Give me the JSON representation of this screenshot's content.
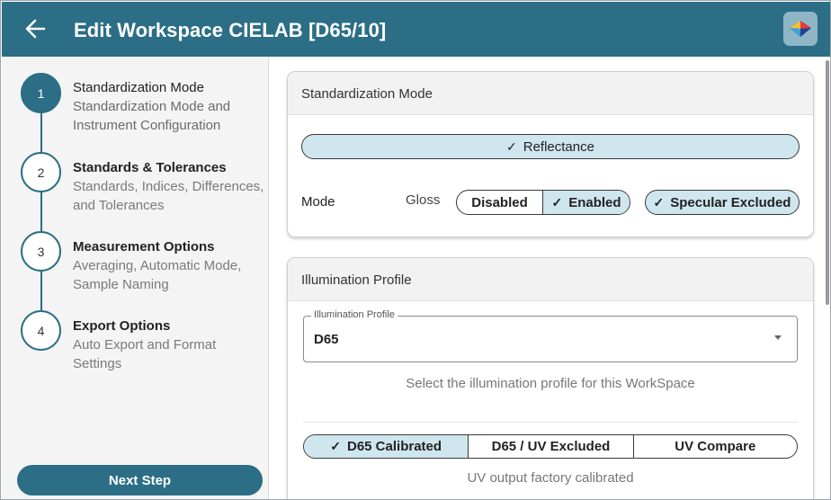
{
  "header": {
    "title": "Edit Workspace CIELAB [D65/10]",
    "back_icon": "arrow-left-icon",
    "logo_icon": "color-diamond-logo-icon",
    "background": "#2b6e86"
  },
  "steps": [
    {
      "number": "1",
      "title": "Standardization Mode",
      "subtitle": "Standardization Mode and Instrument Configuration",
      "active": true
    },
    {
      "number": "2",
      "title": "Standards & Tolerances",
      "subtitle": "Standards, Indices, Differences, and Tolerances",
      "active": false
    },
    {
      "number": "3",
      "title": "Measurement Options",
      "subtitle": "Averaging, Automatic Mode, Sample Naming",
      "active": false
    },
    {
      "number": "4",
      "title": "Export Options",
      "subtitle": "Auto Export and Format Settings",
      "active": false
    }
  ],
  "next_button": "Next Step",
  "standardization": {
    "header": "Standardization Mode",
    "reflectance_label": "Reflectance",
    "mode_label": "Mode",
    "gloss_label": "Gloss",
    "gloss_options": [
      "Disabled",
      "Enabled"
    ],
    "gloss_selected": "Enabled",
    "specular_label": "Specular Excluded"
  },
  "illumination": {
    "header": "Illumination Profile",
    "field_label": "Illumination Profile",
    "field_value": "D65",
    "helper": "Select the illumination profile for this WorkSpace",
    "uv_options": [
      "D65 Calibrated",
      "D65 / UV Excluded",
      "UV Compare"
    ],
    "uv_selected": "D65 Calibrated",
    "uv_helper": "UV output factory calibrated"
  },
  "colors": {
    "accent": "#2b6e86",
    "selected_fill": "#cfe6ef"
  }
}
